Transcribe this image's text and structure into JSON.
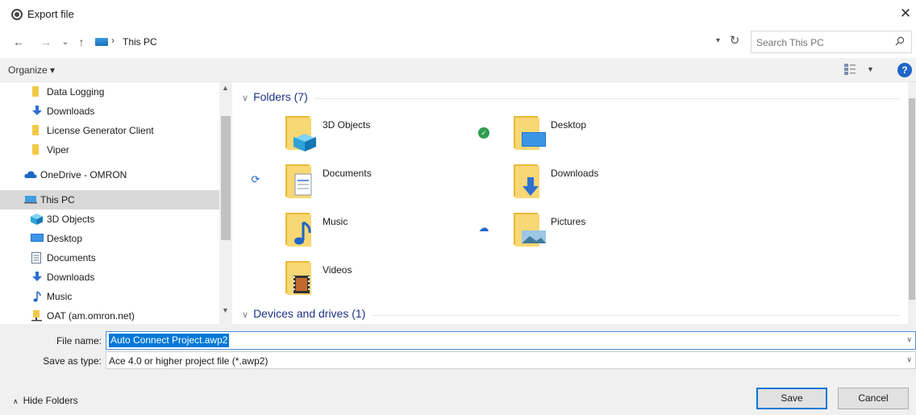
{
  "window": {
    "title": "Export file",
    "close_glyph": "✕"
  },
  "nav": {
    "back": "←",
    "forward": "→",
    "recent": "⌄",
    "up": "↑",
    "breadcrumb_sep": "›",
    "breadcrumb": "This PC",
    "refresh": "↻",
    "search_placeholder": "Search This PC"
  },
  "toolbar": {
    "organize": "Organize ▾"
  },
  "sidebar": {
    "items": [
      {
        "label": "Data Logging",
        "icon": "folder-icon"
      },
      {
        "label": "Downloads",
        "icon": "download-arrow-icon"
      },
      {
        "label": "License Generator Client",
        "icon": "folder-icon"
      },
      {
        "label": "Viper",
        "icon": "folder-icon"
      },
      {
        "label": "OneDrive - OMRON",
        "icon": "cloud-icon"
      },
      {
        "label": "This PC",
        "icon": "computer-icon",
        "selected": true
      },
      {
        "label": "3D Objects",
        "icon": "cube-icon"
      },
      {
        "label": "Desktop",
        "icon": "desktop-icon"
      },
      {
        "label": "Documents",
        "icon": "document-icon"
      },
      {
        "label": "Downloads",
        "icon": "download-arrow-icon"
      },
      {
        "label": "Music",
        "icon": "music-note-icon"
      },
      {
        "label": "OAT (am.omron.net)",
        "icon": "network-drive-icon"
      }
    ]
  },
  "main": {
    "folders_header": "Folders (7)",
    "devices_header": "Devices and drives (1)",
    "folders": [
      {
        "name": "3D Objects",
        "status": ""
      },
      {
        "name": "Desktop",
        "status": "synced"
      },
      {
        "name": "Documents",
        "status": "syncing"
      },
      {
        "name": "Downloads",
        "status": ""
      },
      {
        "name": "Music",
        "status": ""
      },
      {
        "name": "Pictures",
        "status": "cloud"
      },
      {
        "name": "Videos",
        "status": ""
      }
    ]
  },
  "footer": {
    "file_name_label": "File name:",
    "file_name_value": "Auto Connect Project.awp2",
    "save_type_label": "Save as type:",
    "save_type_value": "Ace 4.0 or higher project file (*.awp2)",
    "hide_folders": "Hide Folders",
    "save": "Save",
    "cancel": "Cancel"
  },
  "colors": {
    "accent": "#0078d7",
    "folder": "#f3c846",
    "group_header": "#1e3287"
  }
}
